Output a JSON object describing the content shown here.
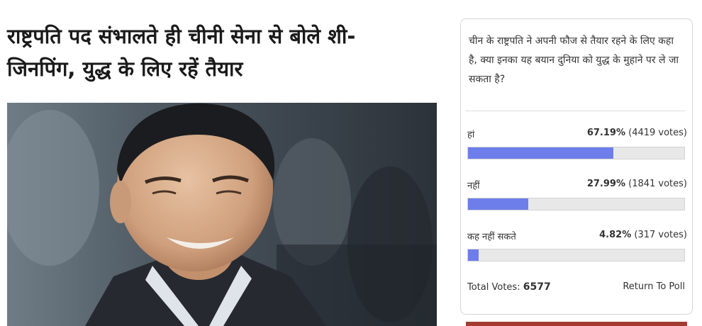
{
  "article": {
    "headline_line1": "राष्ट्रपति पद संभालते ही चीनी सेना से बोले शी-",
    "headline_line2": "जिनपिंग, युद्ध के लिए रहें तैयार"
  },
  "poll": {
    "question": "चीन के राष्ट्रपति ने अपनी फौज से तैयार रहने के लिए कहा है, क्या इनका यह बयान दुनिया को युद्ध के मुहाने पर ले जा सकता है?",
    "answers": [
      {
        "label": "हां",
        "percent": "67.19%",
        "votes": "(4419 votes)",
        "fraction": 0.6719
      },
      {
        "label": "नहीं",
        "percent": "27.99%",
        "votes": "(1841 votes)",
        "fraction": 0.2799
      },
      {
        "label": "कह नहीं सकते",
        "percent": "4.82%",
        "votes": "(317 votes)",
        "fraction": 0.0482
      }
    ],
    "total_label": "Total Votes:",
    "total_value": "6577",
    "return_label": "Return To Poll",
    "bar_color": "#6d7eea",
    "accent_strip_color": "#a23b30"
  }
}
